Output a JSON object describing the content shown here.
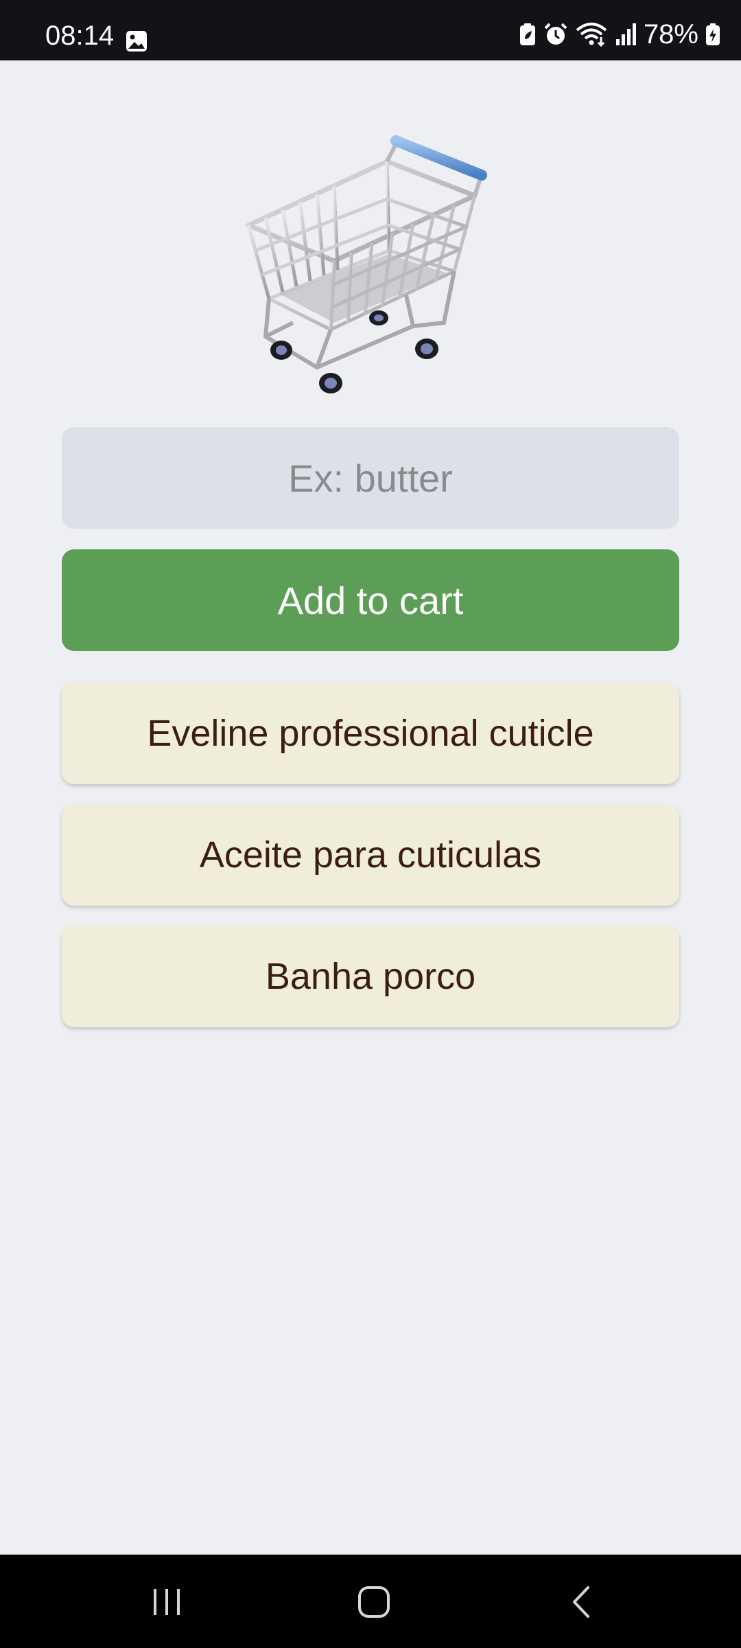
{
  "status_bar": {
    "time": "08:14",
    "battery_percent": "78%",
    "icons": [
      "gallery-icon",
      "battery-saver-icon",
      "alarm-icon",
      "wifi-icon",
      "signal-icon",
      "battery-icon"
    ]
  },
  "cart_image": {
    "icon": "shopping-cart-icon",
    "handle_color": "#6f9fd8"
  },
  "input": {
    "placeholder": "Ex: butter",
    "value": ""
  },
  "add_button": {
    "label": "Add to cart",
    "color": "#5c9e55"
  },
  "cart_items": [
    {
      "label": "Eveline professional cuticle"
    },
    {
      "label": "Aceite para cuticulas"
    },
    {
      "label": "Banha porco"
    }
  ],
  "colors": {
    "background": "#eeeff3",
    "item_background": "#f0eeda",
    "item_text": "#3b1e0e",
    "input_background": "#dde0e8"
  },
  "nav_bar": {
    "buttons": [
      "recents-icon",
      "home-icon",
      "back-icon"
    ]
  }
}
